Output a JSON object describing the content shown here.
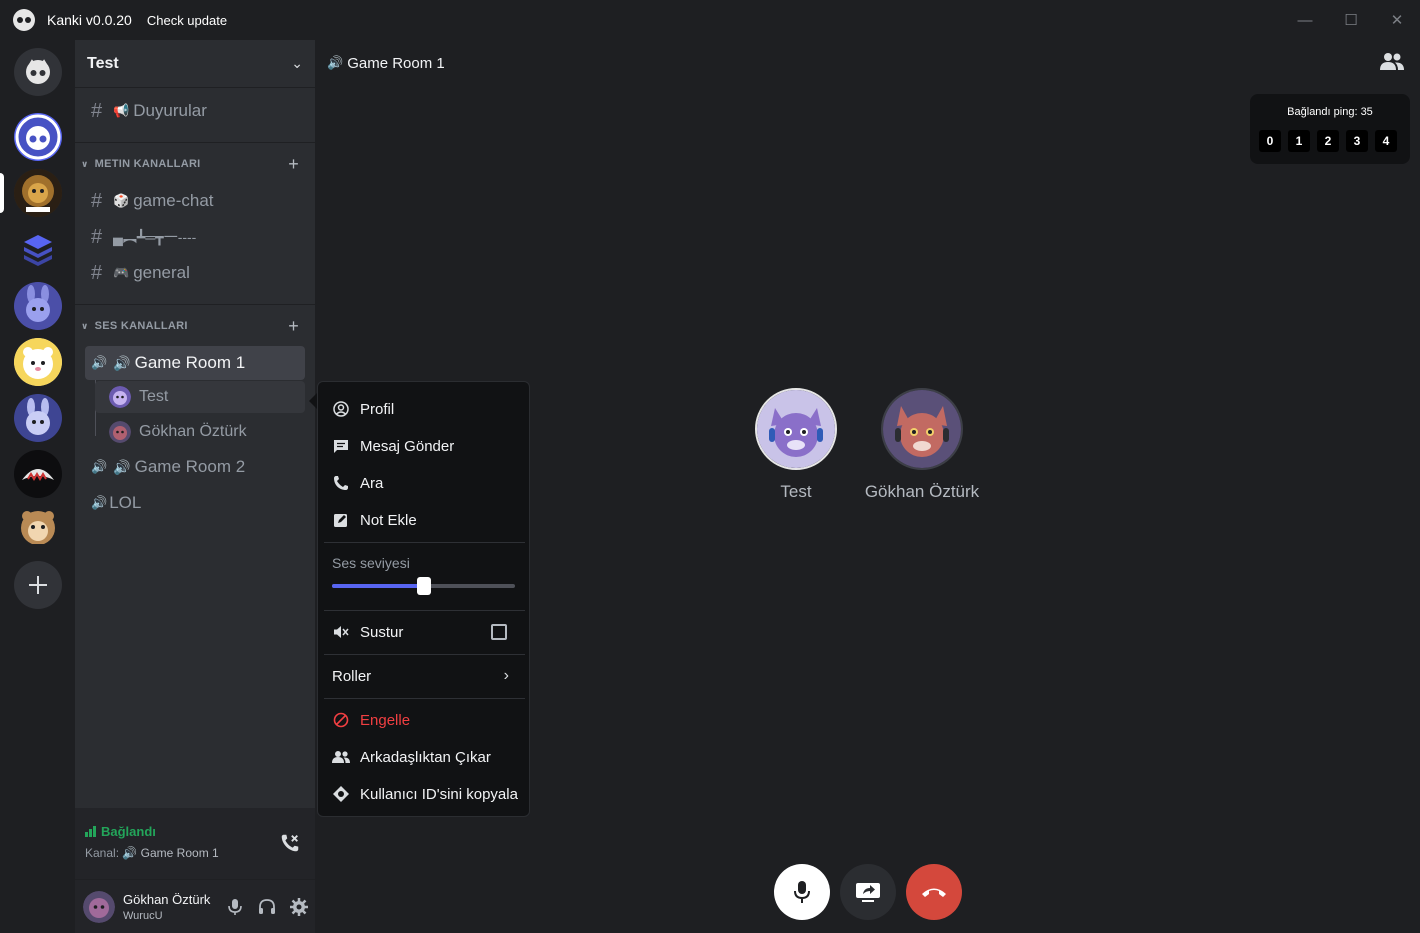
{
  "titlebar": {
    "app_title": "Kanki v0.0.20",
    "check_update": "Check update"
  },
  "server_rail": {
    "icons": [
      "kanki-home-icon",
      "kanki-logo-server",
      "lion-server",
      "layers-server",
      "bunny-server",
      "bear-server",
      "rabbit-server",
      "shark-server",
      "voice-hamster-server",
      "add-server-icon"
    ]
  },
  "sidebar": {
    "server_name": "Test",
    "announcements": {
      "label": "Duyurular",
      "emoji": "📢"
    },
    "text_category": "METIN KANALLARI",
    "text_channels": [
      {
        "label": "game-chat",
        "emoji": "🎲"
      },
      {
        "label": "▄︻┻═┳一---- ",
        "emoji": ""
      },
      {
        "label": "general",
        "emoji": "🎮"
      }
    ],
    "voice_category": "SES KANALLARI",
    "voice_channels": [
      {
        "label": "Game Room 1"
      },
      {
        "label": "Game Room 2"
      },
      {
        "label": "LOL"
      }
    ],
    "voice_users": [
      "Test",
      "Gökhan Öztürk"
    ]
  },
  "voice_panel": {
    "status": "Bağlandı",
    "channel_prefix": "Kanal:",
    "channel_name": "Game Room 1"
  },
  "user_panel": {
    "username": "Gökhan Öztürk",
    "tag": "WurucU"
  },
  "main": {
    "header_title": "Game Room 1",
    "ping_label": "Bağlandı ping: 35",
    "ping_digits": [
      "0",
      "1",
      "2",
      "3",
      "4"
    ],
    "participants": [
      "Test",
      "Gökhan Öztürk"
    ]
  },
  "context_menu": {
    "profile": "Profil",
    "send_message": "Mesaj Gönder",
    "call": "Ara",
    "add_note": "Not Ekle",
    "volume_label": "Ses seviyesi",
    "volume_level": 0.5,
    "mute": "Sustur",
    "mute_checked": false,
    "roles": "Roller",
    "block": "Engelle",
    "remove_friend": "Arkadaşlıktan Çıkar",
    "copy_id": "Kullanıcı ID'sini kopyala"
  },
  "colors": {
    "accent": "#5865f2",
    "danger": "#f23f42",
    "connected": "#23a55a",
    "hangup": "#d4483c"
  }
}
